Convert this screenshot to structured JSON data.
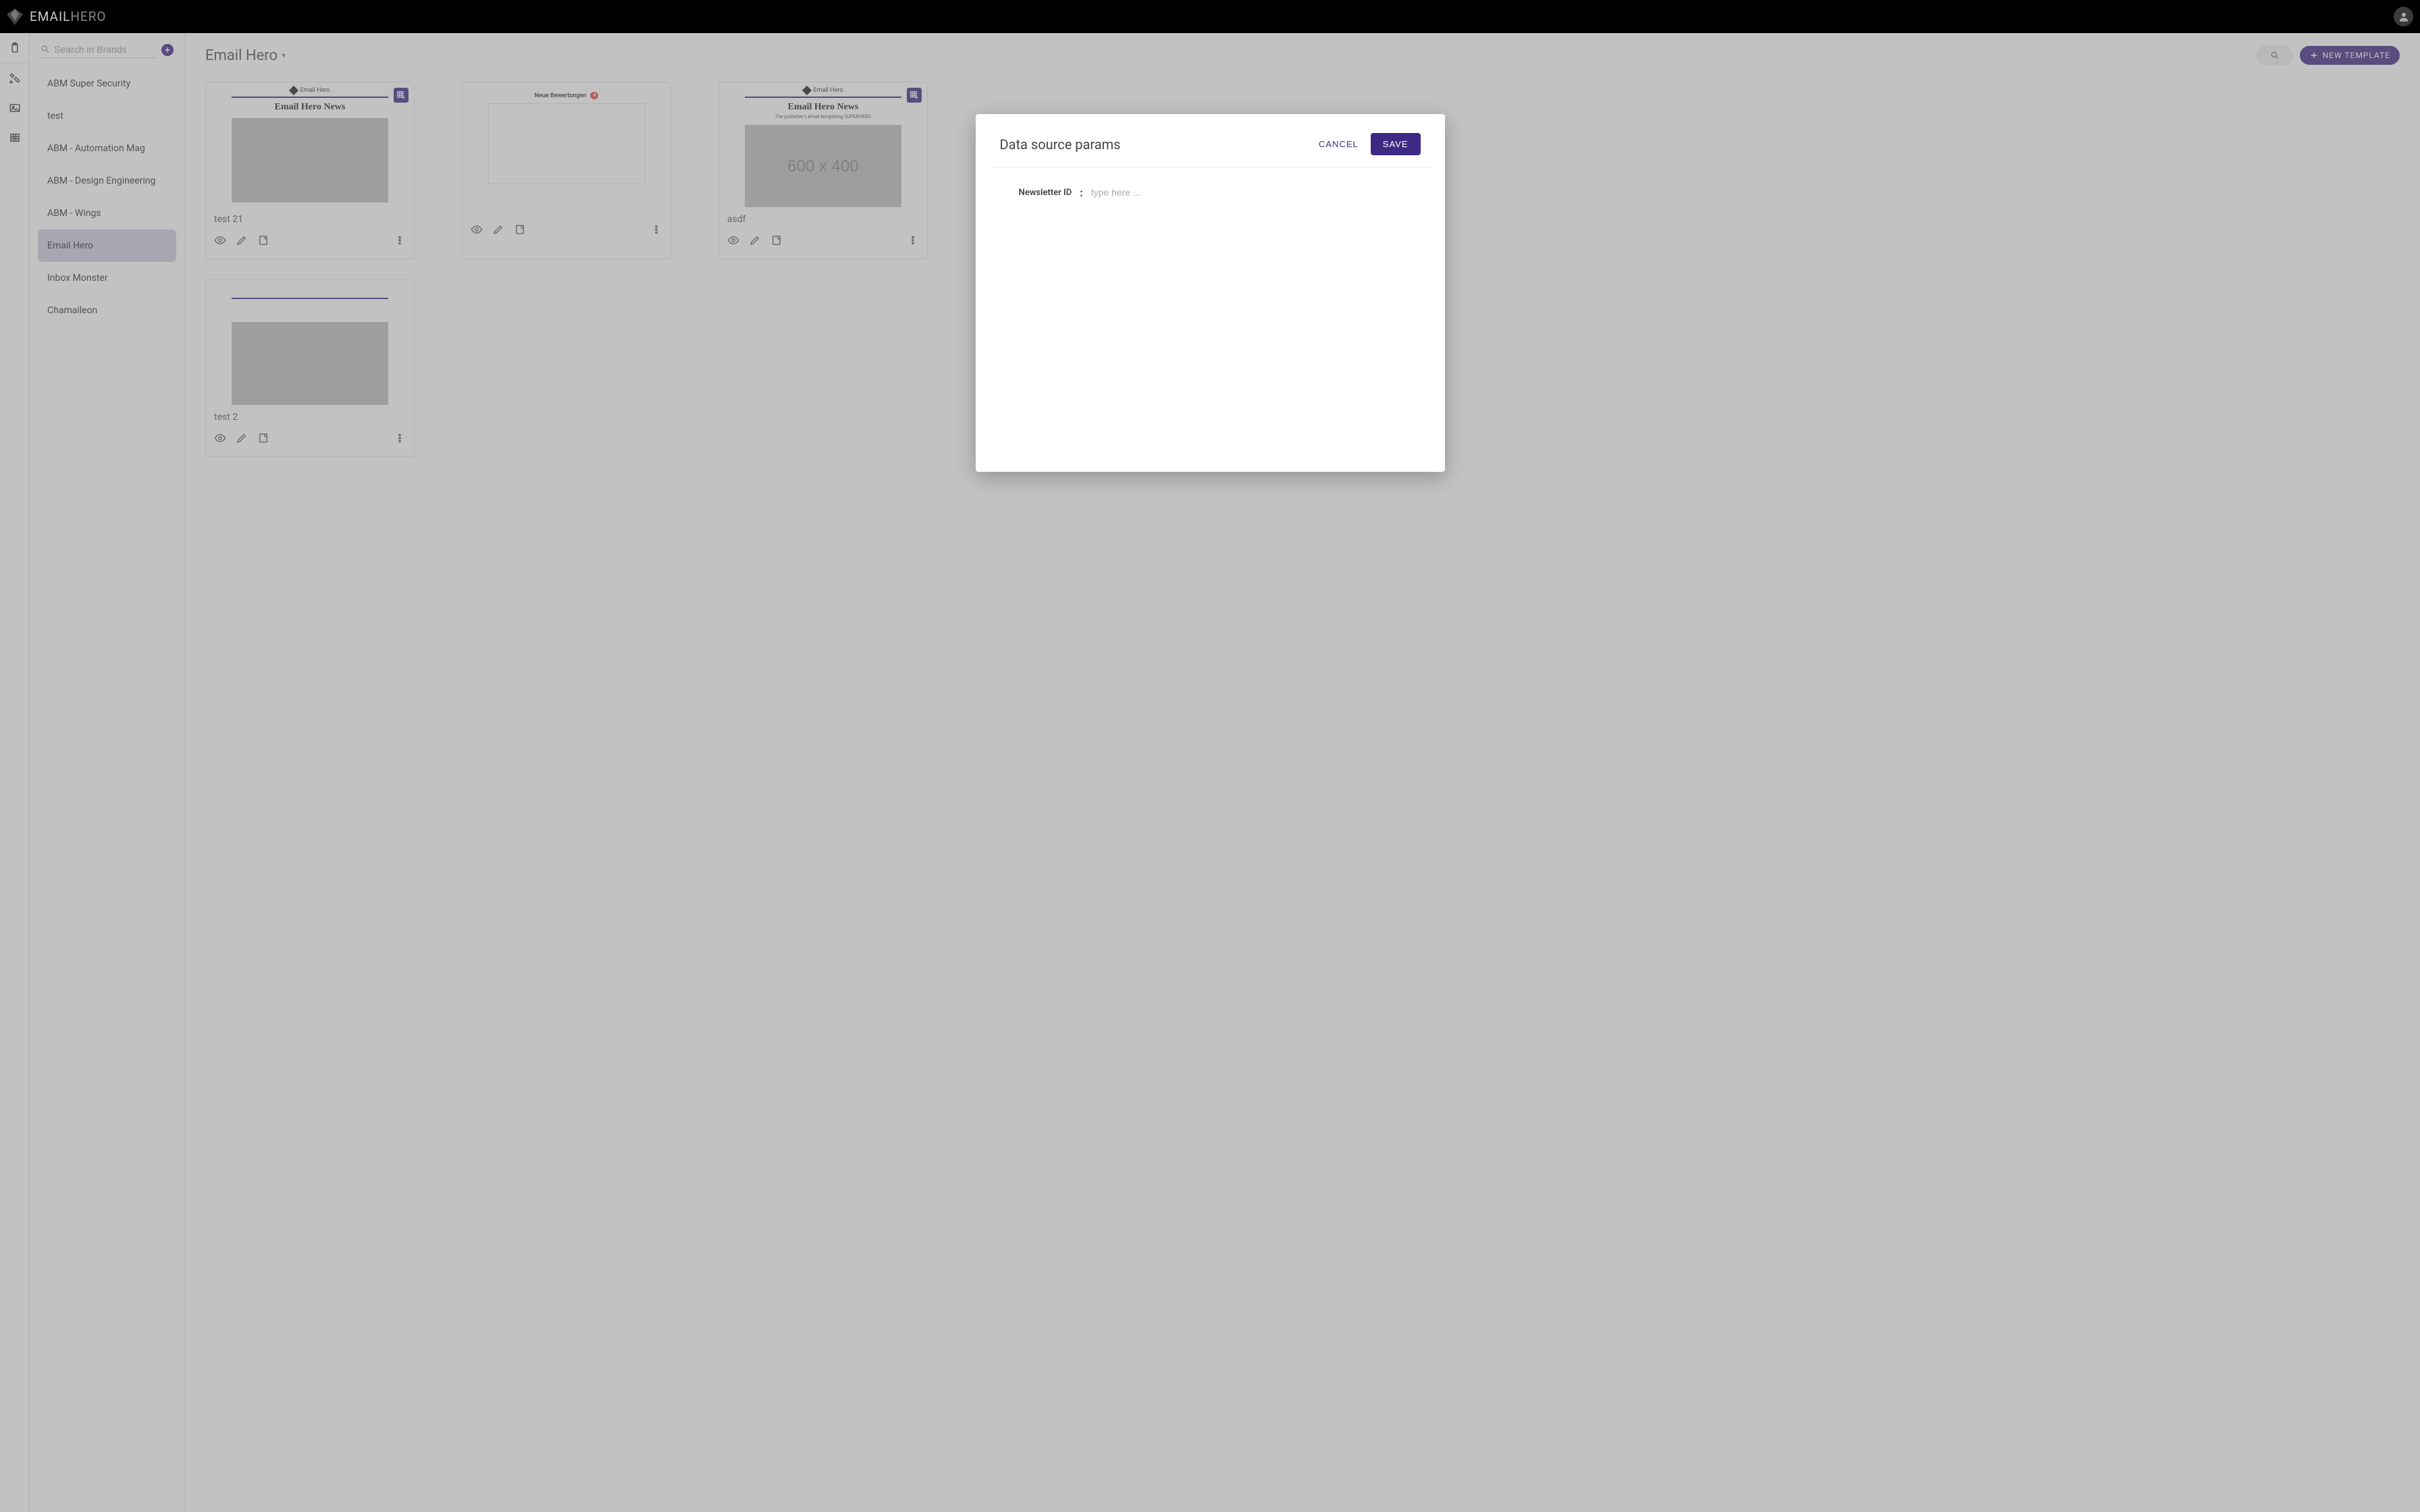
{
  "app": {
    "name_a": "EMAIL",
    "name_b": "HERO"
  },
  "rail": {
    "items": [
      "clipboard",
      "tools",
      "image",
      "table"
    ]
  },
  "brands": {
    "search_placeholder": "Search in Brands",
    "items": [
      {
        "label": "ABM Super Security"
      },
      {
        "label": "test"
      },
      {
        "label": "ABM - Automation Mag"
      },
      {
        "label": "ABM - Design Engineering"
      },
      {
        "label": "ABM - Wings"
      },
      {
        "label": "Email Hero",
        "active": true
      },
      {
        "label": "Inbox Monster"
      },
      {
        "label": "Chamaileon"
      }
    ]
  },
  "header": {
    "breadcrumb": "Email Hero",
    "new_template": "NEW TEMPLATE"
  },
  "templates": [
    {
      "name": "test 21",
      "badge": true,
      "preview": {
        "kind": "news",
        "logo": "Email Hero",
        "title": "Email Hero News",
        "img_text": ""
      }
    },
    {
      "name": "",
      "badge": false,
      "preview": {
        "kind": "german",
        "logo": "",
        "title": "Neue Bewertungen",
        "badge_count": "4"
      }
    },
    {
      "name": "asdf",
      "badge": true,
      "preview": {
        "kind": "news_full",
        "logo": "Email Hero",
        "title": "Email Hero News",
        "subtitle": "The publisher's email templating SUPERHERO",
        "img_text": "600 x 400"
      }
    },
    {
      "name": "test 2",
      "badge": false,
      "preview": {
        "kind": "blank",
        "logo": "",
        "title": ""
      }
    }
  ],
  "modal": {
    "title": "Data source params",
    "cancel": "CANCEL",
    "save": "SAVE",
    "field_label": "Newsletter ID",
    "field_placeholder": "type here ..."
  }
}
